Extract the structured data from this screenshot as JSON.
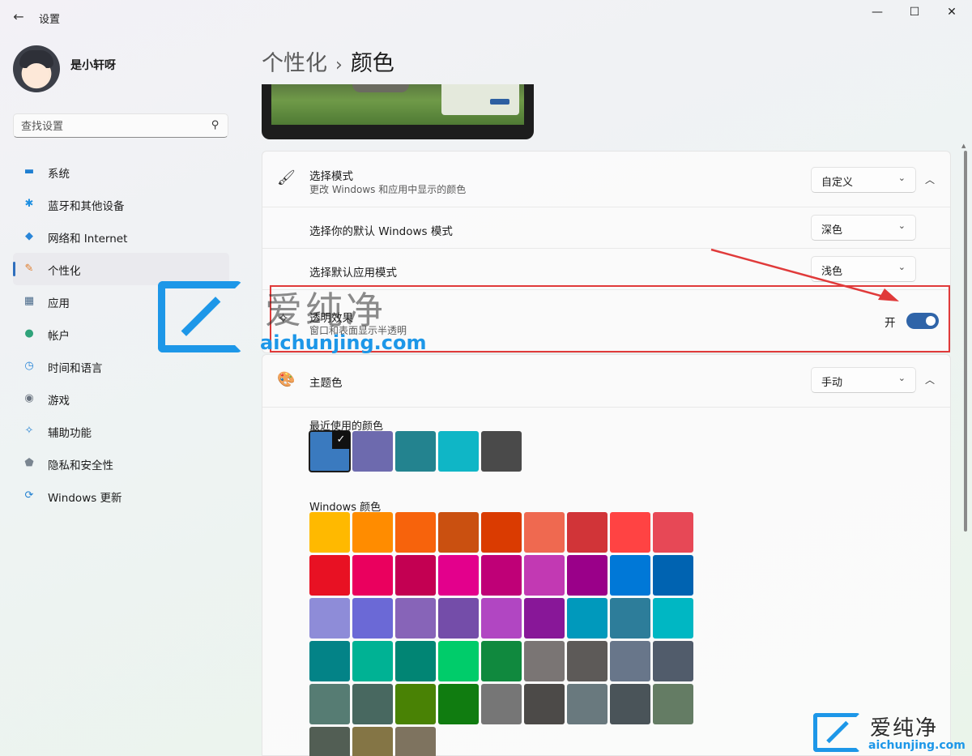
{
  "window": {
    "back_icon": "←",
    "title": "设置",
    "minimize_icon": "—",
    "maximize_icon": "☐",
    "close_icon": "✕"
  },
  "user": {
    "name": "是小轩呀"
  },
  "search": {
    "placeholder": "查找设置",
    "icon": "⚲"
  },
  "sidebar": {
    "items": [
      {
        "label": "系统",
        "icon": "system-icon",
        "glyph": "▬",
        "color": "#1f7fd1",
        "selected": false
      },
      {
        "label": "蓝牙和其他设备",
        "icon": "bluetooth-icon",
        "glyph": "✱",
        "color": "#1d8fe1",
        "selected": false
      },
      {
        "label": "网络和 Internet",
        "icon": "wifi-icon",
        "glyph": "◆",
        "color": "#2a86d8",
        "selected": false
      },
      {
        "label": "个性化",
        "icon": "brush-icon",
        "glyph": "✎",
        "color": "#e07c2a",
        "selected": true
      },
      {
        "label": "应用",
        "icon": "apps-icon",
        "glyph": "▦",
        "color": "#4a6a8a",
        "selected": false
      },
      {
        "label": "帐户",
        "icon": "account-icon",
        "glyph": "●",
        "color": "#2fa37a",
        "selected": false
      },
      {
        "label": "时间和语言",
        "icon": "clock-globe-icon",
        "glyph": "◷",
        "color": "#2a86d8",
        "selected": false
      },
      {
        "label": "游戏",
        "icon": "gamepad-icon",
        "glyph": "◉",
        "color": "#6b7480",
        "selected": false
      },
      {
        "label": "辅助功能",
        "icon": "accessibility-icon",
        "glyph": "✧",
        "color": "#1f7fd1",
        "selected": false
      },
      {
        "label": "隐私和安全性",
        "icon": "shield-icon",
        "glyph": "⬟",
        "color": "#7a8590",
        "selected": false
      },
      {
        "label": "Windows 更新",
        "icon": "update-icon",
        "glyph": "⟳",
        "color": "#1f7fd1",
        "selected": false
      }
    ]
  },
  "breadcrumb": {
    "parent": "个性化",
    "separator": "›",
    "current": "颜色"
  },
  "mode_card": {
    "choose_mode": {
      "title": "选择模式",
      "description": "更改 Windows 和应用中显示的颜色",
      "value": "自定义",
      "icon": "brush-icon"
    },
    "windows_mode": {
      "title": "选择你的默认 Windows 模式",
      "value": "深色"
    },
    "app_mode": {
      "title": "选择默认应用模式",
      "value": "浅色"
    },
    "transparency": {
      "title": "透明效果",
      "description": "窗口和表面显示半透明",
      "state_label": "开",
      "on": true
    }
  },
  "accent_card": {
    "title": "主题色",
    "value": "手动",
    "icon": "palette-icon",
    "recent_label": "最近使用的颜色",
    "recent_colors": [
      "#3a7abf",
      "#6d6aae",
      "#23838f",
      "#0fb6c6",
      "#4a4a4a"
    ],
    "windows_label": "Windows 颜色",
    "windows_colors": [
      [
        "#ffb900",
        "#ff8c00",
        "#f7630c",
        "#ca5010",
        "#da3b01",
        "#ef6950",
        "#d13438",
        "#ff4343",
        "#e74856"
      ],
      [
        "#e81123",
        "#ea005e",
        "#c30052",
        "#e3008c",
        "#bf0077",
        "#c239b3",
        "#9a0089",
        "#0078d7",
        "#0063b1"
      ],
      [
        "#8e8cd8",
        "#6b69d6",
        "#8764b8",
        "#744da9",
        "#b146c2",
        "#881798",
        "#0099bc",
        "#2d7d9a",
        "#00b7c3"
      ],
      [
        "#038387",
        "#00b294",
        "#018574",
        "#00cc6a",
        "#10893e",
        "#7a7574",
        "#5d5a58",
        "#68768a",
        "#515c6b"
      ],
      [
        "#567c73",
        "#486860",
        "#498205",
        "#107c10",
        "#767676",
        "#4c4a48",
        "#69797e",
        "#4a5459",
        "#647c64"
      ],
      [
        "#525e54",
        "#847545",
        "#7e735f"
      ]
    ]
  },
  "watermark": {
    "cn": "爱纯净",
    "url": "aichunjing.com"
  },
  "colors": {
    "accent": "#2f64a8",
    "highlight_red": "#e03a3a",
    "watermark_blue": "#1d97e8"
  }
}
